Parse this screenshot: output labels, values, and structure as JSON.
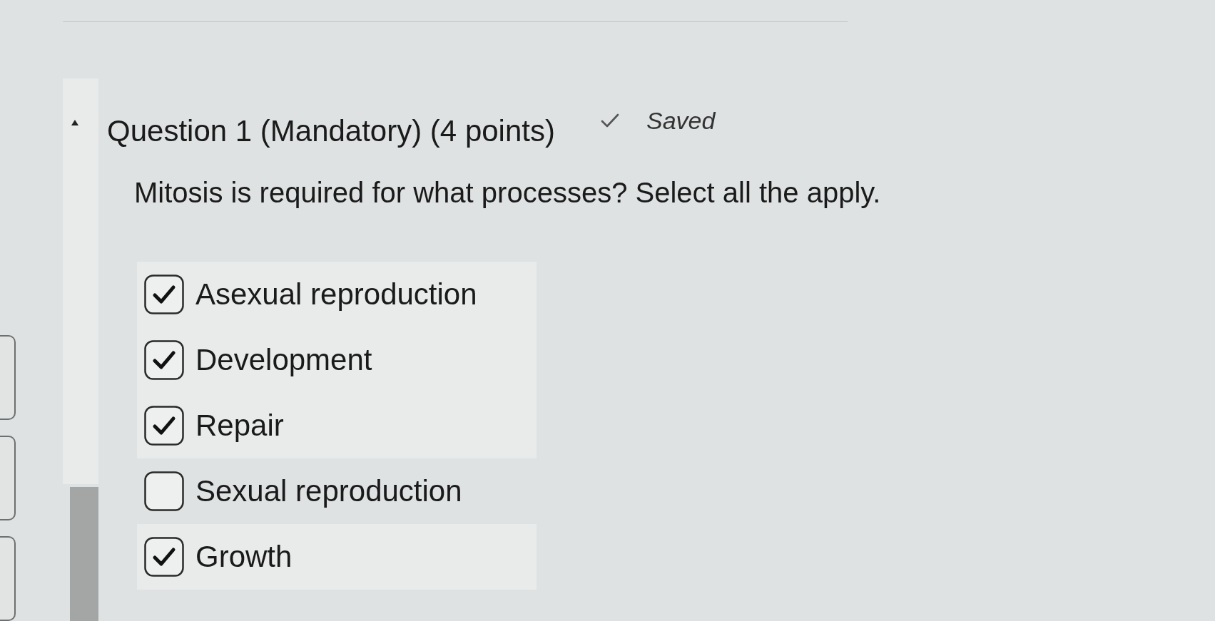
{
  "question": {
    "title": "Question 1 (Mandatory) (4 points)",
    "save_status": {
      "label": "Saved",
      "saved": true
    },
    "prompt": "Mitosis is required for what processes? Select all the apply.",
    "options": [
      {
        "label": "Asexual reproduction",
        "checked": true
      },
      {
        "label": "Development",
        "checked": true
      },
      {
        "label": "Repair",
        "checked": true
      },
      {
        "label": "Sexual reproduction",
        "checked": false
      },
      {
        "label": "Growth",
        "checked": true
      }
    ]
  }
}
